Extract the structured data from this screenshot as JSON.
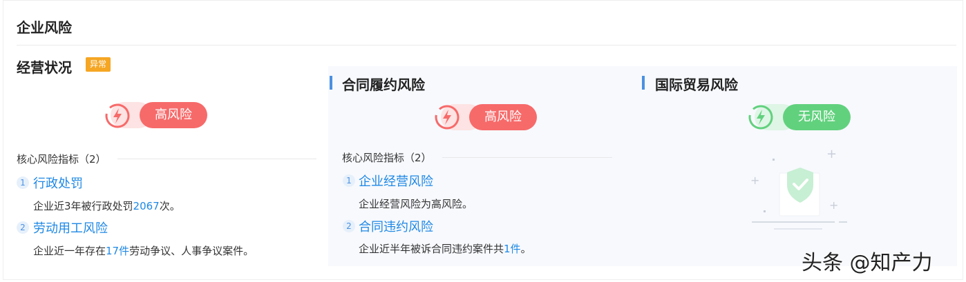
{
  "page": {
    "title": "企业风险"
  },
  "business": {
    "title": "经营状况",
    "badge": "异常",
    "risk_level": "高风险",
    "indicator_header": "核心风险指标（2）",
    "items": [
      {
        "num": "1",
        "title": "行政处罚",
        "desc_pre": "企业近3年被行政处罚",
        "desc_hl": "2067",
        "desc_post": "次。"
      },
      {
        "num": "2",
        "title": "劳动用工风险",
        "desc_pre": "企业近一年存在",
        "desc_hl": "17件",
        "desc_post": "劳动争议、人事争议案件。"
      }
    ]
  },
  "contract": {
    "title": "合同履约风险",
    "risk_level": "高风险",
    "indicator_header": "核心风险指标（2）",
    "items": [
      {
        "num": "1",
        "title": "企业经营风险",
        "desc_pre": "企业经营风险为高风险。",
        "desc_hl": "",
        "desc_post": ""
      },
      {
        "num": "2",
        "title": "合同违约风险",
        "desc_pre": "企业近半年被诉合同违约案件共",
        "desc_hl": "1件",
        "desc_post": "。"
      }
    ]
  },
  "trade": {
    "title": "国际贸易风险",
    "risk_level": "无风险"
  },
  "watermark": "头条 @知产力",
  "colors": {
    "high_risk": "#f76a6a",
    "no_risk": "#62d17e",
    "link": "#1e88e5",
    "badge": "#f5a623",
    "accent_bar": "#4a90e2"
  },
  "icons": {
    "high_risk_icon": "lightning-bolt-circle",
    "no_risk_icon": "lightning-bolt-circle",
    "empty_state": "shield-check"
  }
}
